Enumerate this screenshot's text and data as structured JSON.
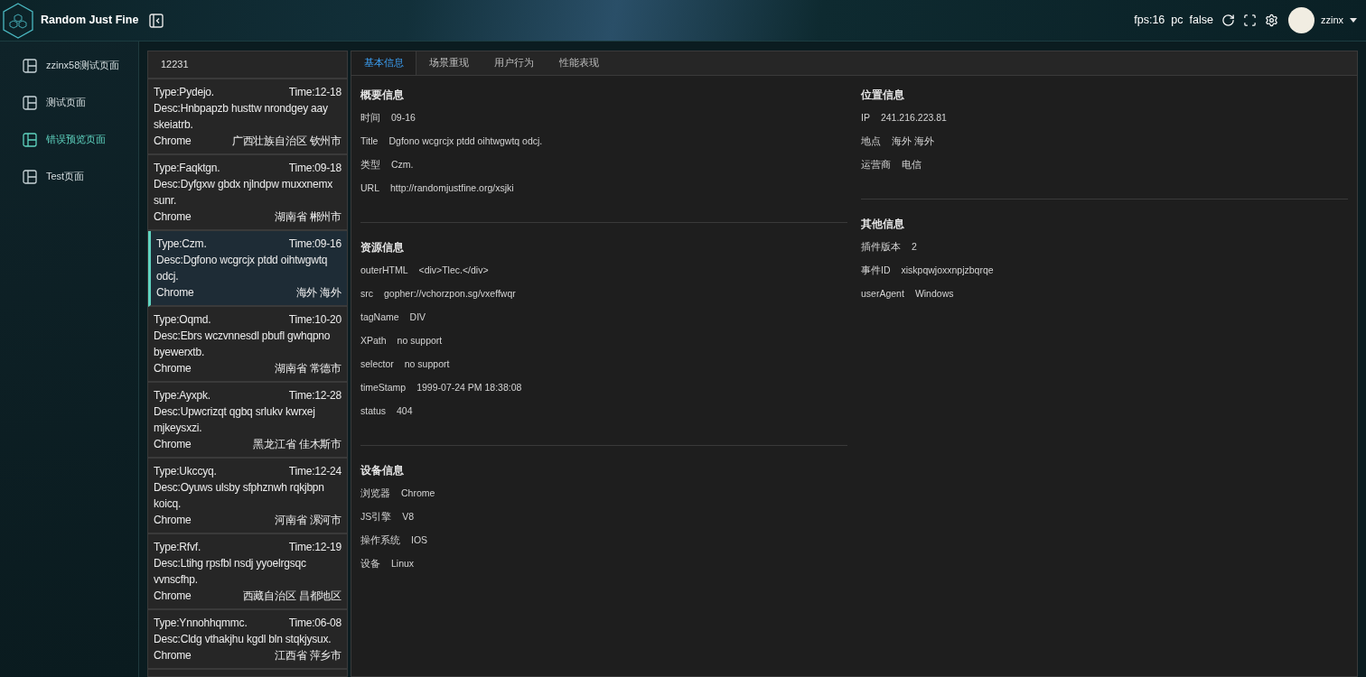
{
  "header": {
    "app_name": "Random Just Fine",
    "status": [
      {
        "text": "fps:16"
      },
      {
        "text": "pc"
      },
      {
        "text": "false"
      }
    ],
    "user": "zzinx"
  },
  "sidebar": {
    "items": [
      {
        "label": "zzinx58测试页面",
        "selected": false
      },
      {
        "label": "测试页面",
        "selected": false
      },
      {
        "label": "错误预览页面",
        "selected": true
      },
      {
        "label": "Test页面",
        "selected": false
      }
    ]
  },
  "error_list": {
    "header": "12231",
    "items": [
      {
        "type": "Type:Pydejo.",
        "time": "Time:12-18",
        "desc": "Desc:Hnbpapzb husttw nrondgey aay skeiatrb.",
        "browser": "Chrome",
        "location": "广西壮族自治区 钦州市",
        "selected": false
      },
      {
        "type": "Type:Faqktgn.",
        "time": "Time:09-18",
        "desc": "Desc:Dyfgxw gbdx njlndpw muxxnemx sunr.",
        "browser": "Chrome",
        "location": "湖南省 郴州市",
        "selected": false
      },
      {
        "type": "Type:Czm.",
        "time": "Time:09-16",
        "desc": "Desc:Dgfono wcgrcjx ptdd oihtwgwtq odcj.",
        "browser": "Chrome",
        "location": "海外 海外",
        "selected": true
      },
      {
        "type": "Type:Oqmd.",
        "time": "Time:10-20",
        "desc": "Desc:Ebrs wczvnnesdl pbufl gwhqpno byewerxtb.",
        "browser": "Chrome",
        "location": "湖南省 常德市",
        "selected": false
      },
      {
        "type": "Type:Ayxpk.",
        "time": "Time:12-28",
        "desc": "Desc:Upwcrizqt qgbq srlukv kwrxej mjkeysxzi.",
        "browser": "Chrome",
        "location": "黑龙江省 佳木斯市",
        "selected": false
      },
      {
        "type": "Type:Ukccyq.",
        "time": "Time:12-24",
        "desc": "Desc:Oyuws ulsby sfphznwh rqkjbpn koicq.",
        "browser": "Chrome",
        "location": "河南省 漯河市",
        "selected": false
      },
      {
        "type": "Type:Rfvf.",
        "time": "Time:12-19",
        "desc": "Desc:Ltihg rpsfbl nsdj yyoelrgsqc vvnscfhp.",
        "browser": "Chrome",
        "location": "西藏自治区 昌都地区",
        "selected": false
      },
      {
        "type": "Type:Ynnohhqmmc.",
        "time": "Time:06-08",
        "desc": "Desc:Cldg vthakjhu kgdl bln stqkjysux.",
        "browser": "Chrome",
        "location": "江西省 萍乡市",
        "selected": false
      }
    ]
  },
  "tabs": [
    {
      "label": "基本信息",
      "selected": true
    },
    {
      "label": "场景重现",
      "selected": false
    },
    {
      "label": "用户行为",
      "selected": false
    },
    {
      "label": "性能表现",
      "selected": false
    }
  ],
  "details": {
    "left_sections": [
      {
        "title": "概要信息",
        "rows": [
          {
            "label": "时间",
            "value": "09-16"
          },
          {
            "label": "Title",
            "value": "Dgfono wcgrcjx ptdd oihtwgwtq odcj."
          },
          {
            "label": "类型",
            "value": "Czm."
          },
          {
            "label": "URL",
            "value": "http://randomjustfine.org/xsjki"
          }
        ]
      },
      {
        "title": "资源信息",
        "rows": [
          {
            "label": "outerHTML",
            "value": "<div>Tlec.</div>"
          },
          {
            "label": "src",
            "value": "gopher://vchorzpon.sg/vxeffwqr"
          },
          {
            "label": "tagName",
            "value": "DIV"
          },
          {
            "label": "XPath",
            "value": "no support"
          },
          {
            "label": "selector",
            "value": "no support"
          },
          {
            "label": "timeStamp",
            "value": "1999-07-24 PM 18:38:08"
          },
          {
            "label": "status",
            "value": "404"
          }
        ]
      },
      {
        "title": "设备信息",
        "rows": [
          {
            "label": "浏览器",
            "value": "Chrome"
          },
          {
            "label": "JS引擎",
            "value": "V8"
          },
          {
            "label": "操作系统",
            "value": "IOS"
          },
          {
            "label": "设备",
            "value": "Linux"
          }
        ]
      }
    ],
    "right_sections": [
      {
        "title": "位置信息",
        "rows": [
          {
            "label": "IP",
            "value": "241.216.223.81"
          },
          {
            "label": "地点",
            "value": "海外 海外"
          },
          {
            "label": "运营商",
            "value": "电信"
          }
        ]
      },
      {
        "title": "其他信息",
        "rows": [
          {
            "label": "插件版本",
            "value": "2"
          },
          {
            "label": "事件ID",
            "value": "xiskpqwjoxxnpjzbqrqe"
          },
          {
            "label": "userAgent",
            "value": "Windows"
          }
        ]
      }
    ]
  }
}
